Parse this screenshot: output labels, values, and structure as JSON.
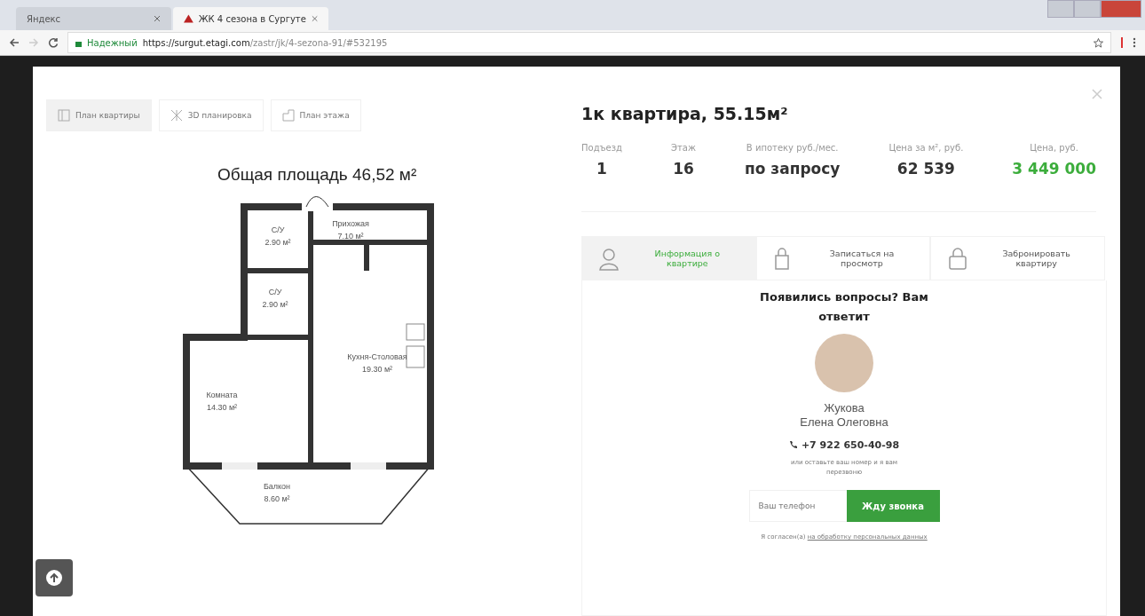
{
  "browser": {
    "tabs": [
      {
        "title": "Яндекс",
        "selected": false
      },
      {
        "title": "ЖК 4 сезона в Сургуте",
        "selected": true
      }
    ],
    "security_label": "Надежный",
    "url_host": "https://surgut.etagi.com",
    "url_path": "/zastr/jk/4-sezona-91/#532195"
  },
  "plan_tabs": [
    {
      "label": "План квартиры",
      "selected": true
    },
    {
      "label": "3D планировка",
      "selected": false
    },
    {
      "label": "План этажа",
      "selected": false
    }
  ],
  "plan": {
    "title": "Общая площадь 46,52 м²",
    "rooms": [
      {
        "name": "Прихожая",
        "area": "7.10 м²"
      },
      {
        "name": "С/У",
        "area": "2.90 м²"
      },
      {
        "name": "С/У",
        "area": "2.90 м²"
      },
      {
        "name": "Кухня-Столовая",
        "area": "19.30 м²"
      },
      {
        "name": "Комната",
        "area": "14.30 м²"
      },
      {
        "name": "Балкон",
        "area": "8.60 м²"
      }
    ]
  },
  "listing": {
    "title": "1к квартира, 55.15м²",
    "stats": [
      {
        "label": "Подъезд",
        "value": "1",
        "kind": "plain"
      },
      {
        "label": "Этаж",
        "value": "16",
        "kind": "plain"
      },
      {
        "label": "В ипотеку руб./мес.",
        "value": "по запросу",
        "kind": "plain"
      },
      {
        "label": "Цена за м², руб.",
        "value": "62 539",
        "kind": "plain"
      },
      {
        "label": "Цена, руб.",
        "value": "3 449 000",
        "kind": "price"
      }
    ]
  },
  "info_tabs": [
    {
      "label": "Информация о квартире",
      "selected": true
    },
    {
      "label": "Записаться на просмотр",
      "selected": false
    },
    {
      "label": "Забронировать квартиру",
      "selected": false
    }
  ],
  "contact": {
    "heading": "Появились вопросы? Вам ответит",
    "surname": "Жукова",
    "name": "Елена Олеговна",
    "phone": "+7 922 650-40-98",
    "hint": "или оставьте ваш номер и я вам перезвоню",
    "phone_field": {
      "placeholder": "Ваш телефон"
    },
    "call_button": "Жду звонка",
    "consent_text": "Я согласен(а)",
    "consent_link": "на обработку персональных данных"
  }
}
